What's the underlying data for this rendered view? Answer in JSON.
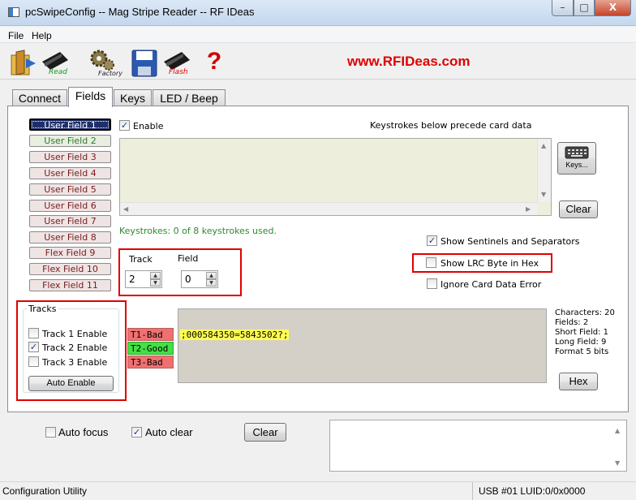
{
  "window": {
    "title": "pcSwipeConfig -- Mag Stripe Reader -- RF IDeas",
    "min": "–",
    "max": "□",
    "close": "X"
  },
  "menu": {
    "file": "File",
    "help": "Help"
  },
  "toolbar": {
    "read_label": "Read",
    "factory_label": "Factory",
    "flash_label": "Flash",
    "help_glyph": "?",
    "url": "www.RFIDeas.com",
    "icons": [
      "open-icon",
      "read-icon",
      "factory-icon",
      "save-icon",
      "flash-icon",
      "help-icon"
    ]
  },
  "tabs": [
    "Connect",
    "Fields",
    "Keys",
    "LED / Beep"
  ],
  "active_tab": "Fields",
  "fields": {
    "buttons": [
      "User Field 1",
      "User Field 2",
      "User Field 3",
      "User Field 4",
      "User Field 5",
      "User Field 6",
      "User Field 7",
      "User Field 8",
      "Flex Field 9",
      "Flex Field 10",
      "Flex Field 11"
    ],
    "selected": "User Field 1",
    "enable_label": "Enable",
    "enable_checked": true,
    "keystrokes_hint": "Keystrokes below precede card data",
    "keys_button": "Keys...",
    "clear_button": "Clear",
    "keystrokes_status": "Keystrokes: 0 of 8 keystrokes used.",
    "track_label": "Track",
    "track_value": "2",
    "field_label": "Field",
    "field_value": "0",
    "show_sentinels_label": "Show Sentinels and Separators",
    "show_sentinels_checked": true,
    "show_lrc_label": "Show LRC Byte in Hex",
    "show_lrc_checked": false,
    "ignore_error_label": "Ignore Card Data Error",
    "ignore_error_checked": false
  },
  "tracks": {
    "legend": "Tracks",
    "items": [
      {
        "label": "Track 1 Enable",
        "checked": false
      },
      {
        "label": "Track 2 Enable",
        "checked": true
      },
      {
        "label": "Track 3 Enable",
        "checked": false
      }
    ],
    "auto_enable": "Auto Enable",
    "status": [
      "T1-Bad",
      "T2-Good",
      "T3-Bad"
    ]
  },
  "card_data": ";000584350=5843502?;",
  "stats": {
    "characters": "Characters: 20",
    "fields": "Fields: 2",
    "short": "Short Field: 1",
    "long": "Long  Field: 9",
    "format": "Format 5 bits",
    "hex_button": "Hex"
  },
  "bottom": {
    "auto_focus_label": "Auto focus",
    "auto_focus_checked": false,
    "auto_clear_label": "Auto clear",
    "auto_clear_checked": true,
    "clear_button": "Clear"
  },
  "status_bar": {
    "left": "Configuration Utility",
    "right": "USB #01 LUID:0/0x0000"
  },
  "colors": {
    "highlight_box": "#e00000",
    "url": "#e00000",
    "status_green": "#2d8a2d"
  }
}
